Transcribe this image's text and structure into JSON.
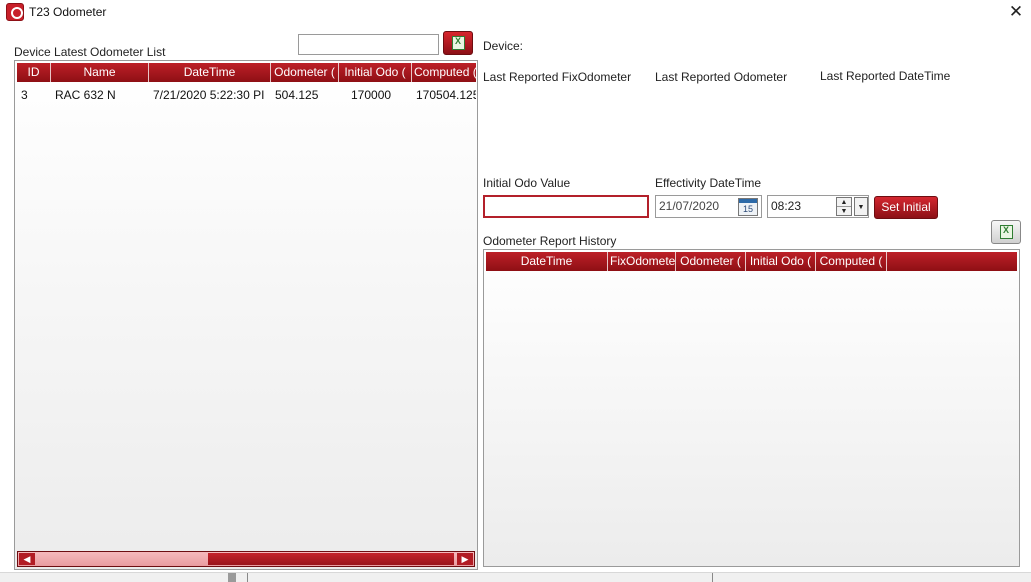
{
  "window": {
    "title": "T23 Odometer",
    "close_glyph": "✕"
  },
  "left": {
    "list_label": "Device Latest Odometer List",
    "search_value": "",
    "columns": [
      "ID",
      "Name",
      "DateTime",
      "Odometer (",
      "Initial Odo (",
      "Computed ("
    ],
    "rows": [
      [
        "3",
        "RAC 632 N",
        "7/21/2020 5:22:30 PI",
        "504.125",
        "170000",
        "170504.125"
      ]
    ]
  },
  "right": {
    "device_label": "Device:",
    "last_fix_label": "Last Reported FixOdometer",
    "last_odo_label": "Last Reported Odometer",
    "last_datetime_label": "Last Reported DateTime",
    "initial_odo_label": "Initial Odo Value",
    "initial_odo_value": "",
    "effectivity_label": "Effectivity DateTime",
    "date_value": "21/07/2020",
    "calendar_day": "15",
    "time_value": "08:23",
    "set_initial_label": "Set Initial",
    "history_label": "Odometer Report History",
    "history_columns": [
      "DateTime",
      "FixOdomete",
      "Odometer (",
      "Initial Odo (",
      "Computed ("
    ]
  },
  "colors": {
    "accent": "#b3202a",
    "accent_dark": "#8c1016"
  },
  "icons": {
    "app": "app-logo-icon",
    "excel": "excel-export-icon",
    "calendar": "calendar-icon"
  }
}
